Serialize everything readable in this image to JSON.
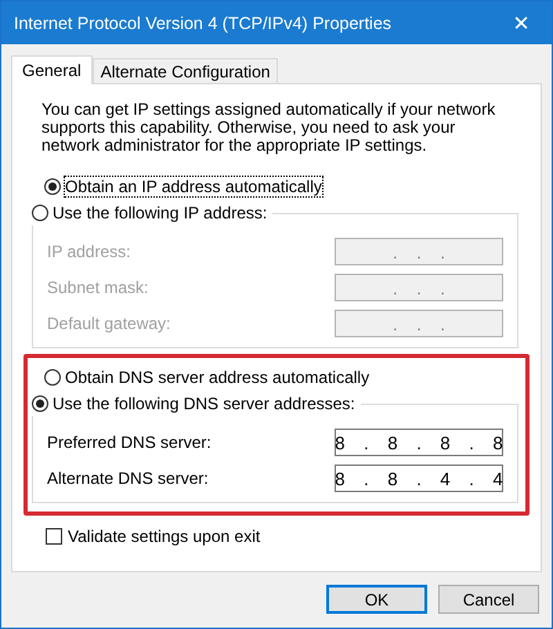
{
  "window": {
    "title": "Internet Protocol Version 4 (TCP/IPv4) Properties",
    "close": "✕"
  },
  "tabs": [
    {
      "label": "General",
      "selected": true
    },
    {
      "label": "Alternate Configuration",
      "selected": false
    }
  ],
  "intro": "You can get IP settings assigned automatically if your network supports this capability. Otherwise, you need to ask your network administrator for the appropriate IP settings.",
  "ip_section": {
    "auto_option": {
      "label": "Obtain an IP address automatically",
      "selected": true,
      "focused": true
    },
    "manual_option": {
      "label": "Use the following IP address:",
      "selected": false
    },
    "fields": [
      {
        "label": "IP address:",
        "value": ". . .",
        "disabled": true
      },
      {
        "label": "Subnet mask:",
        "value": ". . .",
        "disabled": true
      },
      {
        "label": "Default gateway:",
        "value": ". . .",
        "disabled": true
      }
    ]
  },
  "dns_section": {
    "highlighted": true,
    "auto_option": {
      "label": "Obtain DNS server address automatically",
      "selected": false,
      "focused": false
    },
    "manual_option": {
      "label": "Use the following DNS server addresses:",
      "selected": true
    },
    "fields": [
      {
        "label": "Preferred DNS server:",
        "value": "8 . 8 . 8 . 8",
        "disabled": false
      },
      {
        "label": "Alternate DNS server:",
        "value": "8 . 8 . 4 . 4",
        "disabled": false
      }
    ]
  },
  "validate": {
    "label": "Validate settings upon exit",
    "checked": false
  },
  "buttons": [
    {
      "label": "OK",
      "default": true
    },
    {
      "label": "Cancel",
      "default": false
    }
  ]
}
